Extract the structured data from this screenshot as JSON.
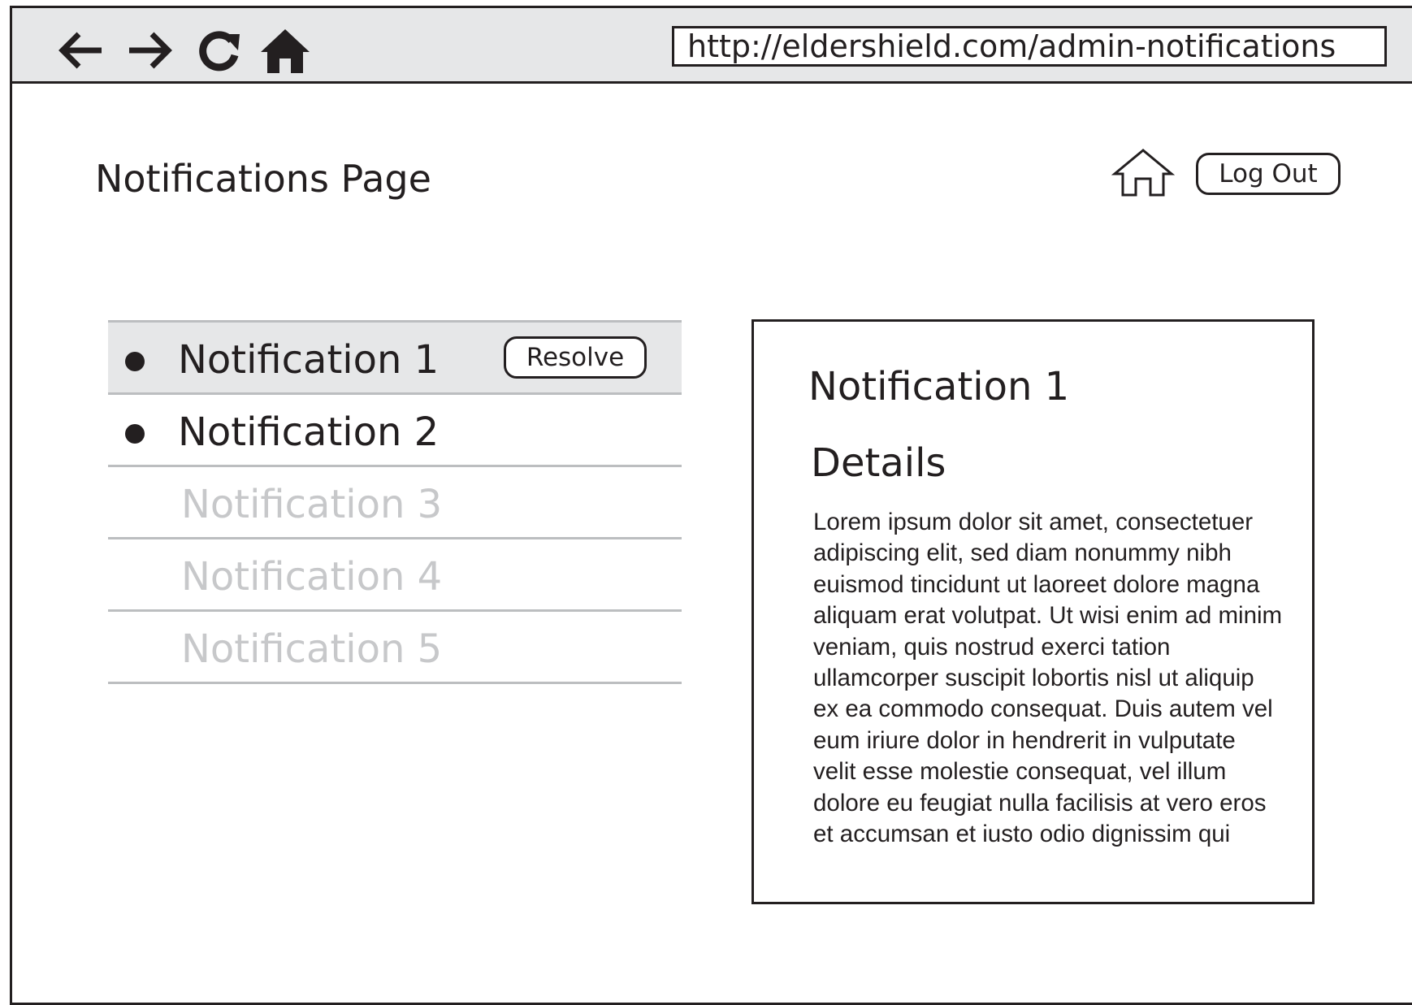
{
  "browser": {
    "url": "http://eldershield.com/admin-notifications",
    "icons": [
      "back-arrow-icon",
      "forward-arrow-icon",
      "reload-icon",
      "home-icon"
    ]
  },
  "header": {
    "title": "Notifications Page",
    "home_icon": "home-outline-icon",
    "logout_label": "Log Out"
  },
  "notifications": {
    "resolve_label": "Resolve",
    "items": [
      {
        "label": "Notification 1",
        "unread": true,
        "selected": true
      },
      {
        "label": "Notification 2",
        "unread": true,
        "selected": false
      },
      {
        "label": "Notification 3",
        "unread": false,
        "selected": false
      },
      {
        "label": "Notification 4",
        "unread": false,
        "selected": false
      },
      {
        "label": "Notification 5",
        "unread": false,
        "selected": false
      }
    ]
  },
  "detail": {
    "title": "Notification 1",
    "subtitle": "Details",
    "body": "Lorem ipsum dolor sit amet, consectetuer adipiscing elit, sed diam nonummy nibh euismod tincidunt ut laoreet dolore magna aliquam erat volutpat. Ut wisi enim ad minim veniam, quis nostrud exerci tation ullamcorper suscipit lobortis nisl ut aliquip ex ea commodo consequat. Duis autem vel eum iriure dolor in hendrerit in vulputate velit esse molestie consequat, vel illum dolore eu feugiat nulla facilisis at vero eros et accumsan et iusto odio dignissim qui"
  },
  "colors": {
    "ink": "#231f20",
    "toolbar_bg": "#e6e7e8",
    "selected_row_bg": "#e6e7e8",
    "divider": "#bcbec0",
    "read_text": "#c7c8ca"
  }
}
